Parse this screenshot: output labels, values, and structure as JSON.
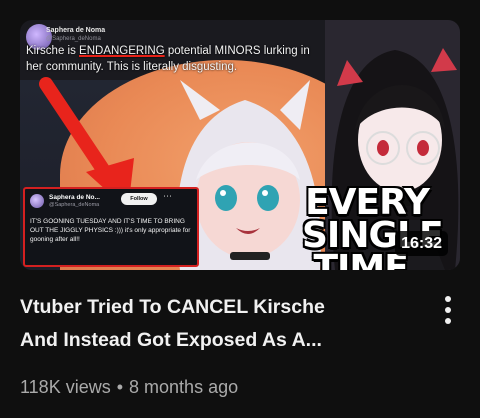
{
  "video": {
    "title_line1": "Vtuber Tried To CANCEL Kirsche",
    "title_line2": "And Instead Got Exposed As A...",
    "views": "118K views",
    "separator": "•",
    "age": "8 months ago",
    "duration": "16:32"
  },
  "thumbnail": {
    "tweet_user": "Saphera de Noma",
    "tweet_handle": "@Saphera_deNoma",
    "tweet_text_part1": "Kirsche is ",
    "tweet_text_emph": "ENDANGERING",
    "tweet_text_part2": " potential MINORS lurking in her community. This is literally disgusting.",
    "card_name": "Saphera de No...",
    "card_handle": "@Saphera_deNoma",
    "card_follow": "Follow",
    "card_more": "⋯",
    "card_body": "IT'S GOONING TUESDAY AND IT'S TIME TO BRING OUT THE JIGGLY PHYSICS :))) it's only appropriate for gooning after all!!",
    "overlay_line1": "EVERY",
    "overlay_line2": "SINGLE",
    "overlay_line3": "TIME."
  },
  "menu": {
    "icon": "more-vert-icon"
  },
  "colors": {
    "background": "#0f0f0f",
    "title": "#f1f1f1",
    "meta": "#aaaaaa",
    "accent_red": "#e62117"
  }
}
